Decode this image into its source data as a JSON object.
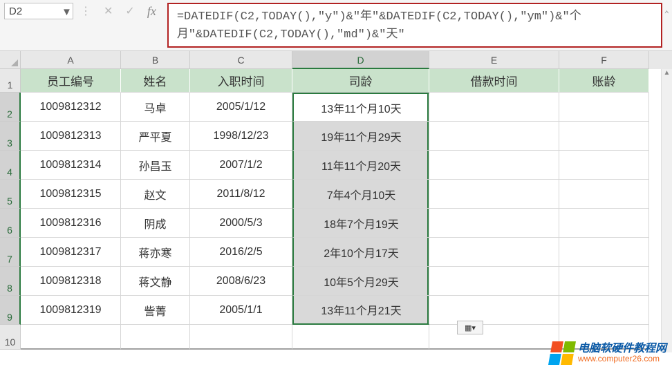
{
  "namebox": {
    "value": "D2"
  },
  "formula_bar": {
    "icons": {
      "dropdown": "▼",
      "cancel": "✕",
      "confirm": "✓",
      "fx": "fx"
    },
    "formula": "=DATEDIF(C2,TODAY(),\"y\")&\"年\"&DATEDIF(C2,TODAY(),\"ym\")&\"个月\"&DATEDIF(C2,TODAY(),\"md\")&\"天\"",
    "expand": "⌃"
  },
  "columns": {
    "A": "A",
    "B": "B",
    "C": "C",
    "D": "D",
    "E": "E",
    "F": "F"
  },
  "header_row": {
    "A": "员工编号",
    "B": "姓名",
    "C": "入职时间",
    "D": "司龄",
    "E": "借款时间",
    "F": "账龄"
  },
  "rows": [
    {
      "n": "2",
      "A": "1009812312",
      "B": "马卓",
      "C": "2005/1/12",
      "D": "13年11个月10天"
    },
    {
      "n": "3",
      "A": "1009812313",
      "B": "严平夏",
      "C": "1998/12/23",
      "D": "19年11个月29天"
    },
    {
      "n": "4",
      "A": "1009812314",
      "B": "孙昌玉",
      "C": "2007/1/2",
      "D": "11年11个月20天"
    },
    {
      "n": "5",
      "A": "1009812315",
      "B": "赵文",
      "C": "2011/8/12",
      "D": "7年4个月10天"
    },
    {
      "n": "6",
      "A": "1009812316",
      "B": "阴成",
      "C": "2000/5/3",
      "D": "18年7个月19天"
    },
    {
      "n": "7",
      "A": "1009812317",
      "B": "蒋亦寒",
      "C": "2016/2/5",
      "D": "2年10个月17天"
    },
    {
      "n": "8",
      "A": "1009812318",
      "B": "蒋文静",
      "C": "2008/6/23",
      "D": "10年5个月29天"
    },
    {
      "n": "9",
      "A": "1009812319",
      "B": "訾菁",
      "C": "2005/1/1",
      "D": "13年11个月21天"
    }
  ],
  "empty_row": {
    "n": "10"
  },
  "paste_options": {
    "label": "▦▾"
  },
  "watermark": {
    "line1": "电脑软硬件教程网",
    "line2": "www.computer26.com"
  }
}
